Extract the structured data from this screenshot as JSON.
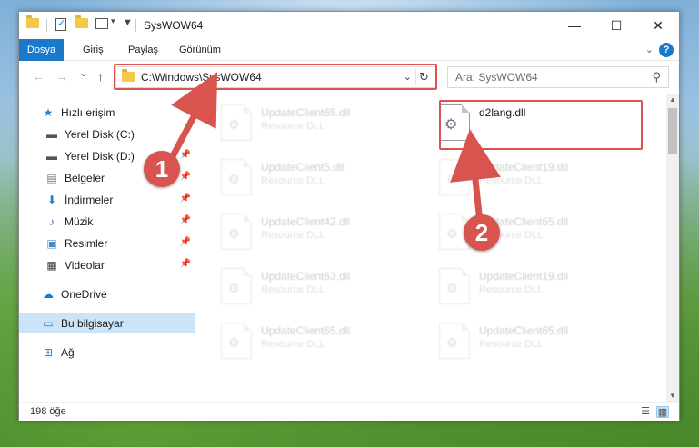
{
  "window": {
    "title": "SysWOW64",
    "minimize_glyph": "—",
    "maximize_glyph": "☐",
    "close_glyph": "✕"
  },
  "ribbon": {
    "tabs": [
      "Dosya",
      "Giriş",
      "Paylaş",
      "Görünüm"
    ],
    "help": "?"
  },
  "nav": {
    "back": "←",
    "forward": "→",
    "recent": "⌄",
    "up": "↑",
    "address": "C:\\Windows\\SysWOW64",
    "search_placeholder": "Ara: SysWOW64"
  },
  "sidebar": {
    "items": [
      {
        "label": "Hızlı erişim",
        "icon": "star-icon"
      },
      {
        "label": "Yerel Disk (C:)",
        "icon": "drive-icon"
      },
      {
        "label": "Yerel Disk (D:)",
        "icon": "drive-icon"
      },
      {
        "label": "Belgeler",
        "icon": "documents-icon"
      },
      {
        "label": "İndirmeler",
        "icon": "download-icon"
      },
      {
        "label": "Müzik",
        "icon": "music-icon"
      },
      {
        "label": "Resimler",
        "icon": "pictures-icon"
      },
      {
        "label": "Videolar",
        "icon": "video-icon"
      },
      {
        "label": "OneDrive",
        "icon": "cloud-icon"
      },
      {
        "label": "Bu bilgisayar",
        "icon": "computer-icon"
      },
      {
        "label": "Ağ",
        "icon": "network-icon"
      }
    ]
  },
  "files": {
    "left": [
      {
        "name": "UpdateClient65.dll",
        "type": "Resource DLL"
      },
      {
        "name": "UpdateClient5.dll",
        "type": "Resource DLL"
      },
      {
        "name": "UpdateClient42.dll",
        "type": "Resource DLL"
      },
      {
        "name": "UpdateClient63.dll",
        "type": "Resource DLL"
      },
      {
        "name": "UpdateClient65.dll",
        "type": "Resource DLL"
      }
    ],
    "right": [
      {
        "name": "d2lang.dll",
        "type": ""
      },
      {
        "name": "UpdateClient19.dll",
        "type": "Resource DLL"
      },
      {
        "name": "UpdateClient65.dll",
        "type": "Resource DLL"
      },
      {
        "name": "UpdateClient19.dll",
        "type": "Resource DLL"
      },
      {
        "name": "UpdateClient65.dll",
        "type": "Resource DLL"
      }
    ]
  },
  "status": {
    "count": "198 öğe"
  },
  "annotations": {
    "step1": "1",
    "step2": "2",
    "color": "#d9534f"
  }
}
